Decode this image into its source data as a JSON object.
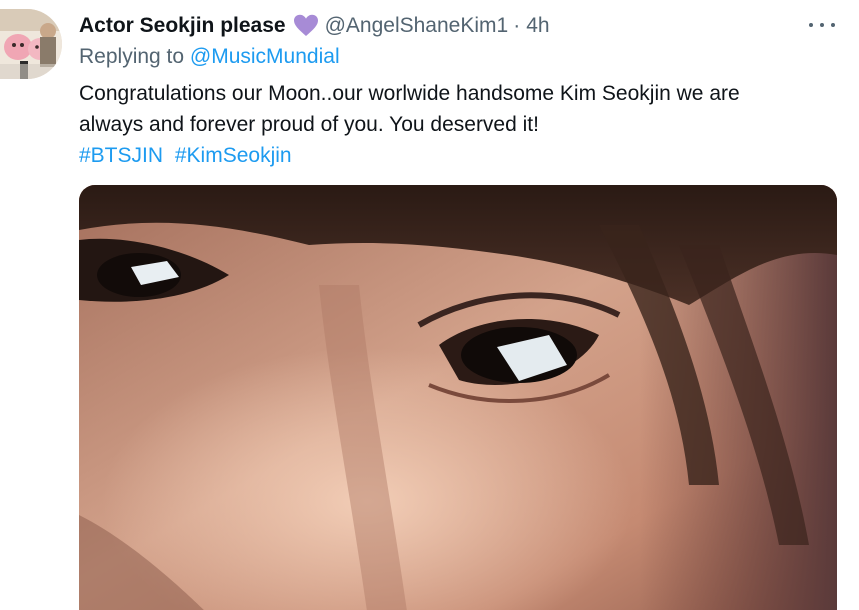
{
  "tweet": {
    "display_name": "Actor Seokjin please",
    "handle": "@AngelShaneKim1",
    "separator": "·",
    "time": "4h",
    "reply_prefix": "Replying to",
    "reply_to": "@MusicMundial",
    "text_line1": "Congratulations our Moon..our worlwide handsome Kim Seokjin we are",
    "text_line2": "always and forever proud of you. You deserved it!",
    "hashtags": [
      "#BTSJIN",
      "#KimSeokjin"
    ]
  },
  "icons": {
    "heart": "purple-heart-icon",
    "more": "more-options-icon"
  },
  "colors": {
    "link": "#1d9bf0",
    "secondary_text": "#536471",
    "primary_text": "#0f1419",
    "heart": "#a78bd6"
  }
}
